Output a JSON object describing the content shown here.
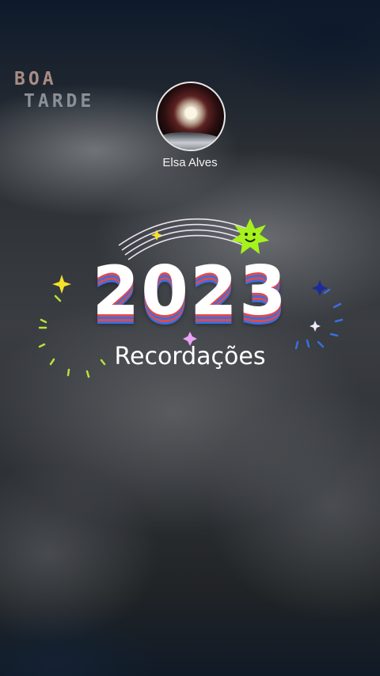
{
  "greeting": {
    "line1": "BOA",
    "line2": "TARDE"
  },
  "profile": {
    "name": "Elsa Alves",
    "avatar_icon": "avatar-moon-photo"
  },
  "memories": {
    "year": "2023",
    "subtitle": "Recordações"
  },
  "colors": {
    "accent_red": "#e24a4a",
    "accent_blue": "#3a6fe0",
    "sparkle_yellow": "#f5e12a",
    "sun_green": "#a6f21c",
    "sparkle_pink": "#e9a3f5"
  }
}
